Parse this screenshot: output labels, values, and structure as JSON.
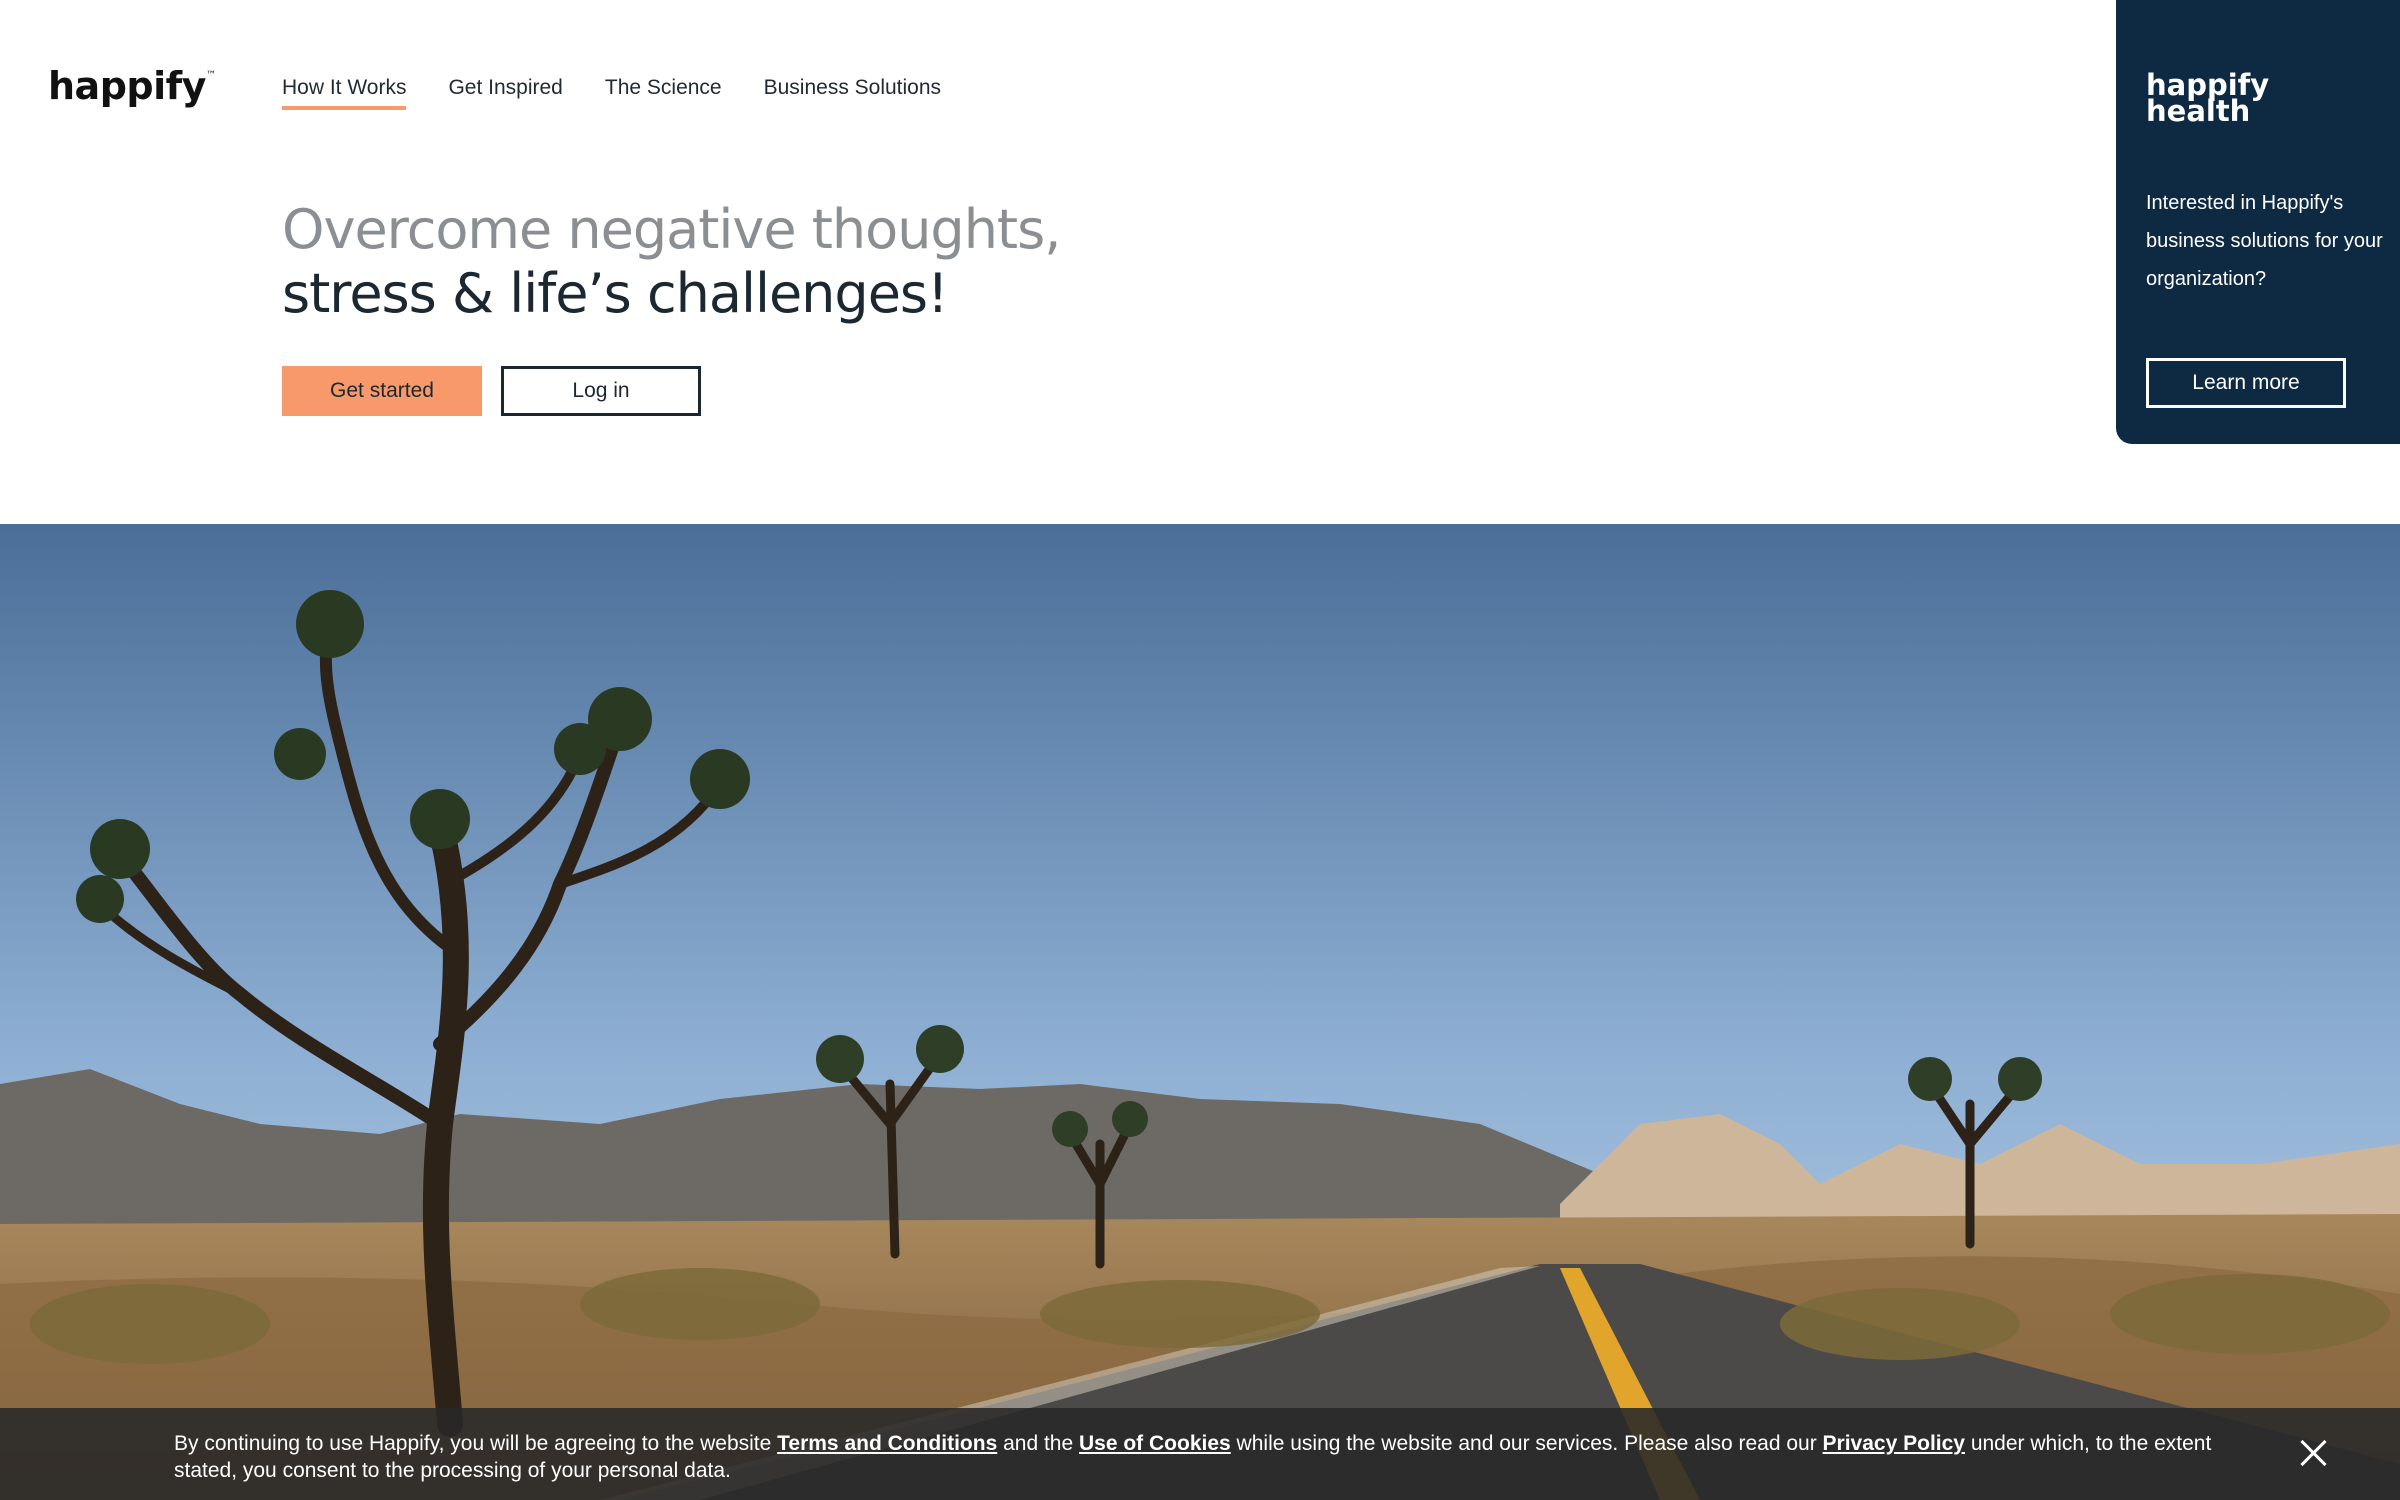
{
  "brand": {
    "logo": "happify",
    "trademark": "™"
  },
  "nav": {
    "items": [
      {
        "label": "How It Works",
        "active": true
      },
      {
        "label": "Get Inspired",
        "active": false
      },
      {
        "label": "The Science",
        "active": false
      },
      {
        "label": "Business Solutions",
        "active": false
      }
    ]
  },
  "hero": {
    "headline_line1": "Overcome negative thoughts,",
    "headline_line2": "stress & life’s challenges!",
    "primary_button": "Get started",
    "secondary_button": "Log in"
  },
  "side_panel": {
    "logo_line1": "happify",
    "logo_line2": "health",
    "text": "Interested in Happify's business solutions for your organization?",
    "button": "Learn more"
  },
  "cookie_banner": {
    "text1": "By continuing to use Happify, you will be agreeing to the website ",
    "link_terms": "Terms and Conditions",
    "text2": " and the ",
    "link_cookies": "Use of Cookies",
    "text3": " while using the website and our services. Please also read our ",
    "link_privacy": "Privacy Policy",
    "text4": " under which, to the extent stated, you consent to the processing of your personal data."
  },
  "colors": {
    "accent": "#f7996a",
    "navy": "#0e2a42",
    "text_dark": "#1b2832",
    "text_gray": "#8a8f94"
  }
}
